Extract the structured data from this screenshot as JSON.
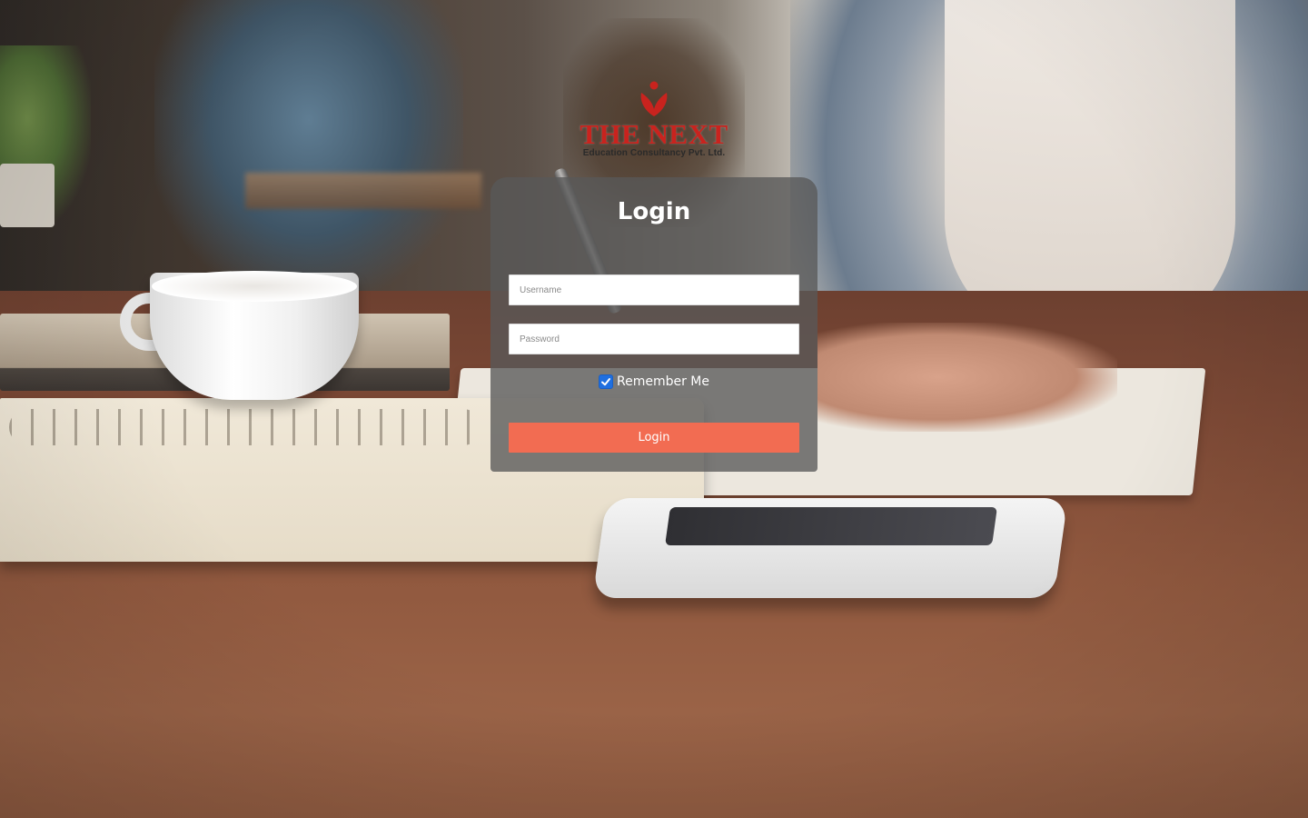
{
  "logo": {
    "name": "THE NEXT",
    "subtitle": "Education Consultancy Pvt. Ltd.",
    "mark_icon": "person-leaf-logo-icon",
    "color": "#c9231e"
  },
  "login_form": {
    "title": "Login",
    "username": {
      "placeholder": "Username",
      "value": ""
    },
    "password": {
      "placeholder": "Password",
      "value": ""
    },
    "remember_me": {
      "label": "Remember Me",
      "checked": true
    },
    "submit_label": "Login"
  },
  "colors": {
    "button": "#f26c52",
    "card_background": "rgba(88,88,88,0.78)",
    "checkbox": "#1f6fe0"
  },
  "background": {
    "description_icon": "desk-background-photo"
  }
}
